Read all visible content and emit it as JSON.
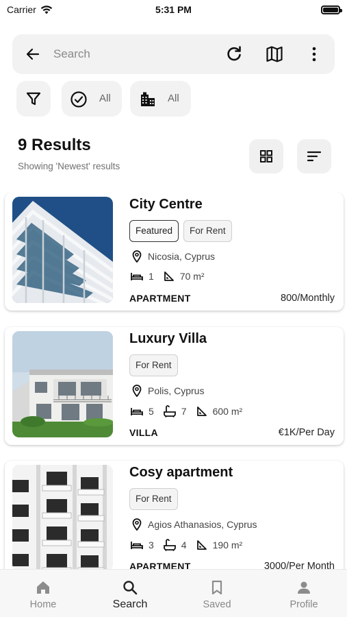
{
  "status_bar": {
    "carrier": "Carrier",
    "time": "5:31 PM"
  },
  "search": {
    "placeholder": "Search"
  },
  "filters": {
    "status_value": "All",
    "type_value": "All"
  },
  "results": {
    "title": "9 Results",
    "subtitle": "Showing 'Newest' results"
  },
  "listings": [
    {
      "name": "City Centre",
      "tags": [
        "Featured",
        "For Rent"
      ],
      "location": "Nicosia, Cyprus",
      "bedrooms": "1",
      "area": "70 m²",
      "type": "APARTMENT",
      "price": "800/Monthly"
    },
    {
      "name": "Luxury Villa",
      "tags": [
        "For Rent"
      ],
      "location": "Polis, Cyprus",
      "bedrooms": "5",
      "bathrooms": "7",
      "area": "600 m²",
      "type": "VILLA",
      "price": "€1K/Per Day"
    },
    {
      "name": "Cosy apartment",
      "tags": [
        "For Rent"
      ],
      "location": "Agios Athanasios, Cyprus",
      "bedrooms": "3",
      "bathrooms": "4",
      "area": "190 m²",
      "type": "APARTMENT",
      "price": "3000/Per Month"
    }
  ],
  "tabbar": {
    "items": [
      {
        "label": "Home",
        "icon": "home-icon"
      },
      {
        "label": "Search",
        "icon": "search-icon",
        "active": true
      },
      {
        "label": "Saved",
        "icon": "bookmark-icon"
      },
      {
        "label": "Profile",
        "icon": "person-icon"
      }
    ]
  }
}
